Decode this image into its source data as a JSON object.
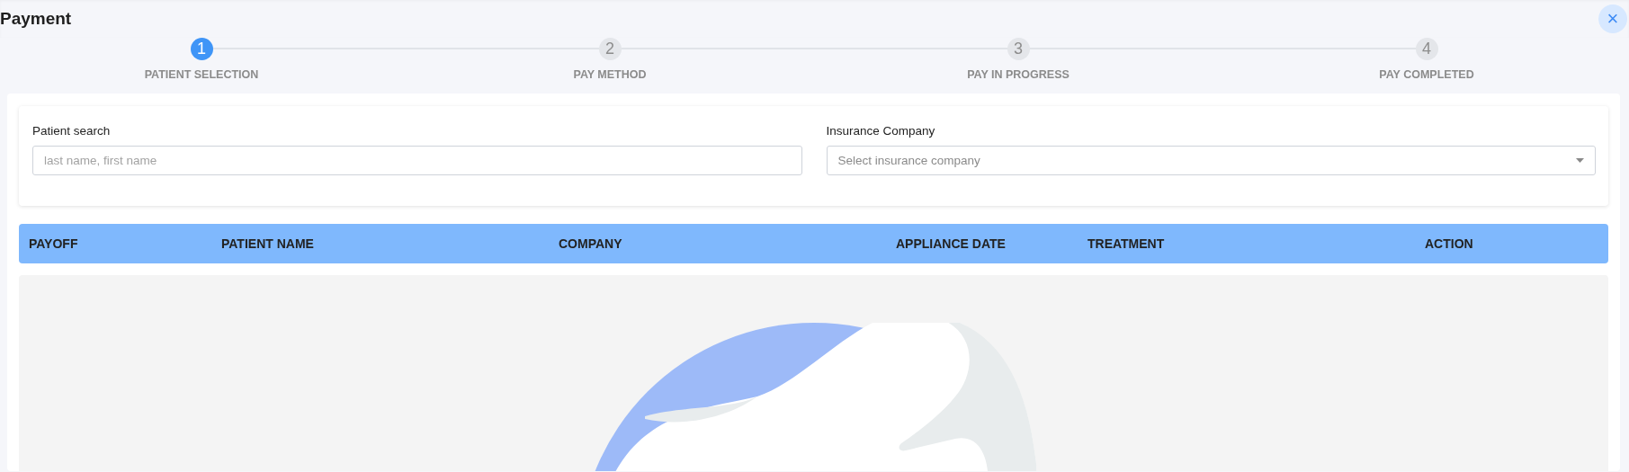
{
  "window": {
    "title": "Payment",
    "close": "×"
  },
  "steps": [
    {
      "number": "1",
      "label": "PATIENT SELECTION",
      "selected": true
    },
    {
      "number": "2",
      "label": "PAY METHOD",
      "selected": false
    },
    {
      "number": "3",
      "label": "PAY IN PROGRESS",
      "selected": false
    },
    {
      "number": "4",
      "label": "PAY COMPLETED",
      "selected": false
    }
  ],
  "filters": [
    {
      "kind": "text",
      "label": "Patient search",
      "placeholder": "last name, first name"
    },
    {
      "kind": "select",
      "label": "Insurance Company",
      "placeholder": "Select insurance company"
    }
  ],
  "table": {
    "columns": [
      "PAYOFF",
      "PATIENT NAME",
      "COMPANY",
      "APPLIANCE DATE",
      "TREATMENT",
      "ACTION"
    ]
  }
}
